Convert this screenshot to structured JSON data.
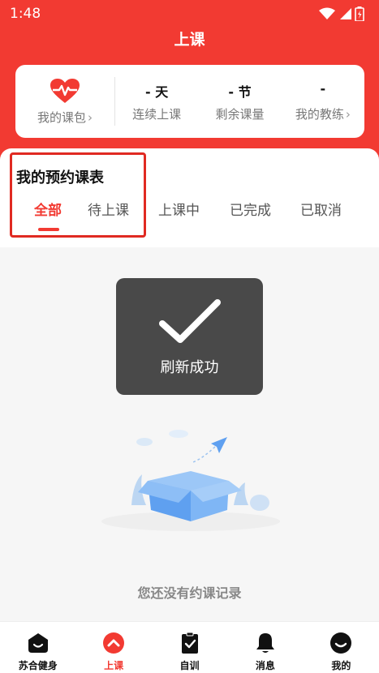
{
  "status_bar": {
    "time": "1:48"
  },
  "page": {
    "title": "上课"
  },
  "stats_card": {
    "package": {
      "label": "我的课包"
    },
    "stats": [
      {
        "value": "- 天",
        "label": "连续上课"
      },
      {
        "value": "- 节",
        "label": "剩余课量"
      },
      {
        "value": "-",
        "label": "我的教练"
      }
    ]
  },
  "bookings": {
    "title": "我的预约课表",
    "tabs": [
      {
        "label": "全部",
        "active": true
      },
      {
        "label": "待上课",
        "active": false
      },
      {
        "label": "上课中",
        "active": false
      },
      {
        "label": "已完成",
        "active": false
      },
      {
        "label": "已取消",
        "active": false
      }
    ]
  },
  "toast": {
    "text": "刷新成功"
  },
  "empty_state": {
    "text": "您还没有约课记录"
  },
  "tabbar": {
    "items": [
      {
        "label": "苏合健身",
        "icon": "home-icon"
      },
      {
        "label": "上课",
        "icon": "class-icon",
        "active": true
      },
      {
        "label": "自训",
        "icon": "clipboard-check-icon"
      },
      {
        "label": "消息",
        "icon": "bell-icon"
      },
      {
        "label": "我的",
        "icon": "profile-icon"
      }
    ]
  },
  "colors": {
    "brand": "#f23a32",
    "toast_bg": "#3a3a3a",
    "empty_text": "#888888"
  }
}
